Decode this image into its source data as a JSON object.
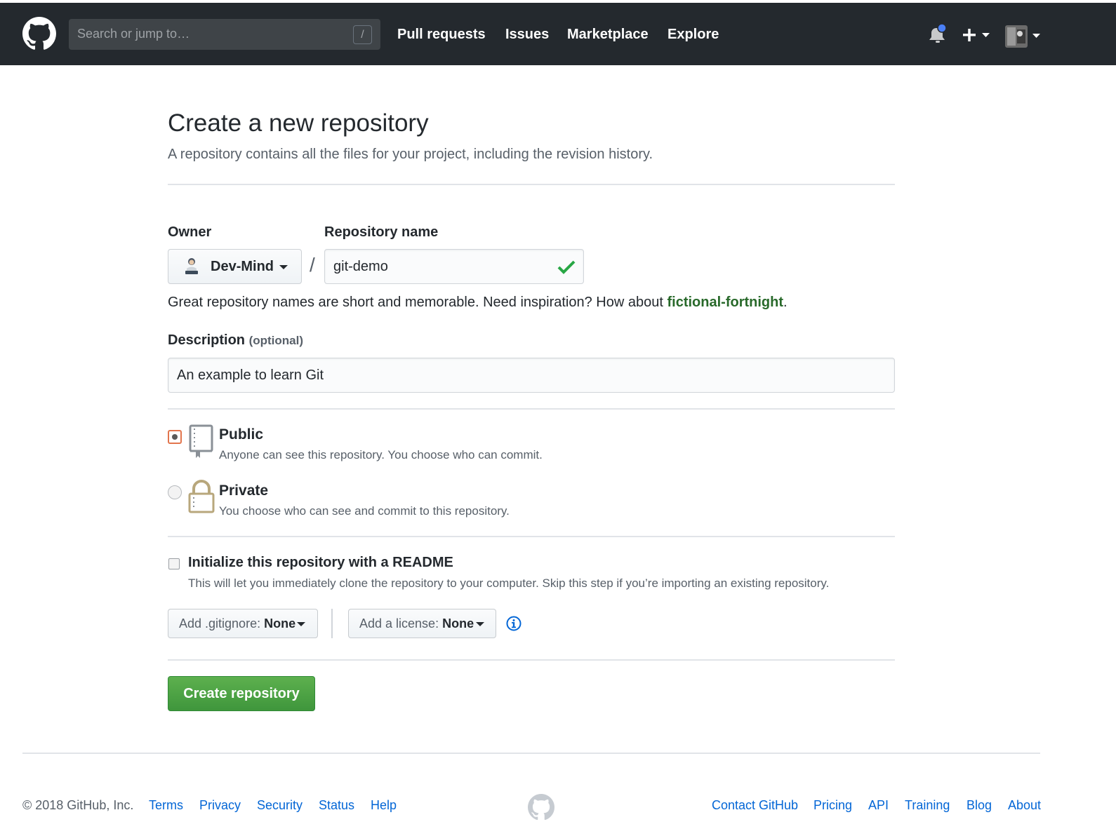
{
  "header": {
    "search_placeholder": "Search or jump to…",
    "search_shortcut": "/",
    "nav": [
      "Pull requests",
      "Issues",
      "Marketplace",
      "Explore"
    ],
    "icons": [
      "github-logo-icon",
      "bell-icon",
      "plus-icon",
      "chevron-down-icon",
      "avatar"
    ]
  },
  "page": {
    "title": "Create a new repository",
    "subtitle": "A repository contains all the files for your project, including the revision history."
  },
  "form": {
    "owner_label": "Owner",
    "owner_value": "Dev-Mind",
    "separator": "/",
    "repo_label": "Repository name",
    "repo_value": "git-demo",
    "hint_prefix": "Great repository names are short and memorable. Need inspiration? How about ",
    "hint_suggestion": "fictional-fortnight",
    "hint_suffix": ".",
    "desc_label": "Description",
    "desc_optional": "(optional)",
    "desc_value": "An example to learn Git",
    "visibility": [
      {
        "title": "Public",
        "desc": "Anyone can see this repository. You choose who can commit.",
        "checked": true
      },
      {
        "title": "Private",
        "desc": "You choose who can see and commit to this repository.",
        "checked": false
      }
    ],
    "readme_title": "Initialize this repository with a README",
    "readme_desc": "This will let you immediately clone the repository to your computer. Skip this step if you’re importing an existing repository.",
    "gitignore_label": "Add .gitignore:",
    "gitignore_value": "None",
    "license_label": "Add a license:",
    "license_value": "None",
    "create_button": "Create repository"
  },
  "footer": {
    "copyright": "© 2018 GitHub, Inc.",
    "left_links": [
      "Terms",
      "Privacy",
      "Security",
      "Status",
      "Help"
    ],
    "right_links": [
      "Contact GitHub",
      "Pricing",
      "API",
      "Training",
      "Blog",
      "About"
    ]
  },
  "colors": {
    "header_bg": "#24292e",
    "accent_green": "#28a745",
    "link_blue": "#0366d6",
    "suggestion_green": "#28692a",
    "notification_dot": "#4a7ff5"
  }
}
